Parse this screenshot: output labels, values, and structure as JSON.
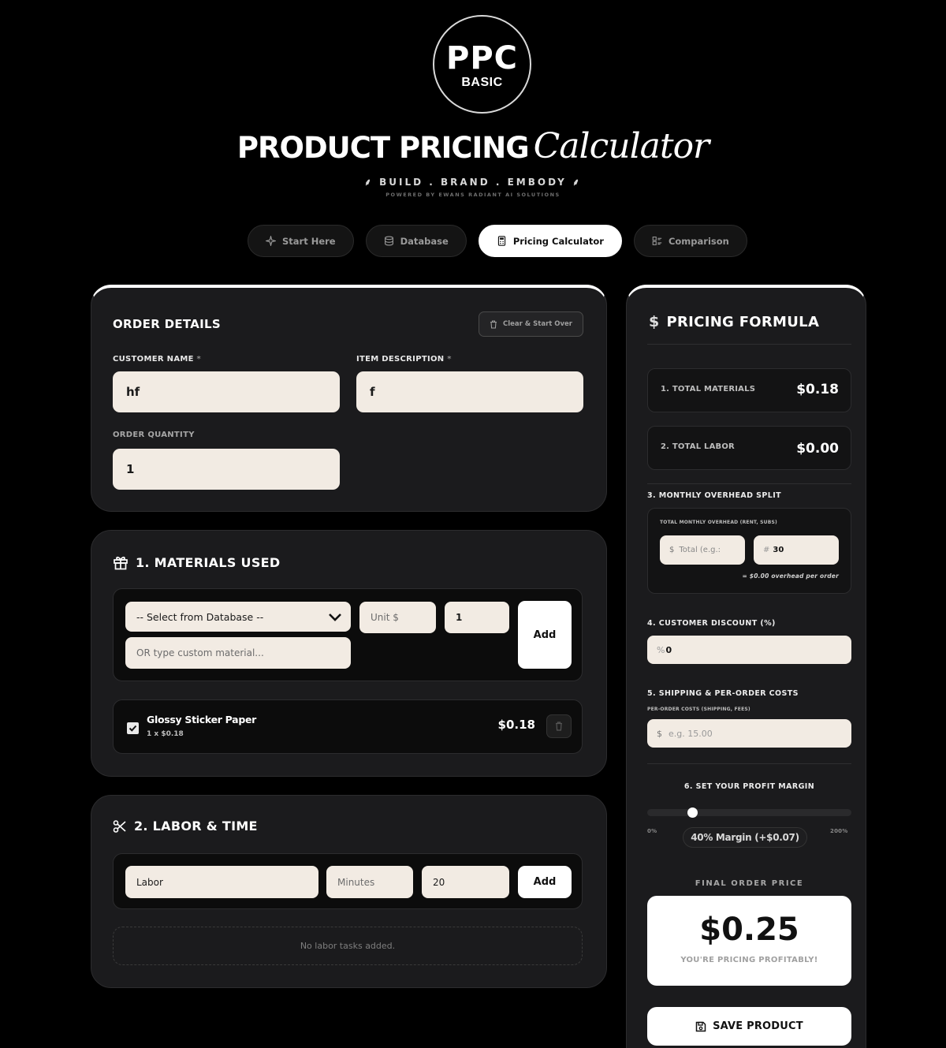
{
  "logo": {
    "main": "PPC",
    "sub": "BASIC"
  },
  "header": {
    "title_bold": "PRODUCT PRICING",
    "title_script": "Calculator",
    "tagline": "BUILD . BRAND . EMBODY",
    "powered_by": "POWERED BY EWANS RADIANT AI SOLUTIONS"
  },
  "tabs": [
    {
      "label": "Start Here",
      "icon": "sparkle-icon"
    },
    {
      "label": "Database",
      "icon": "database-icon"
    },
    {
      "label": "Pricing Calculator",
      "icon": "calculator-icon",
      "active": true
    },
    {
      "label": "Comparison",
      "icon": "comparison-icon"
    }
  ],
  "order": {
    "heading": "ORDER DETAILS",
    "clear_button": "Clear & Start Over",
    "customer_label": "CUSTOMER NAME",
    "customer_value": "hf",
    "item_label": "ITEM DESCRIPTION",
    "item_value": "f",
    "required_mark": "*",
    "quantity_label": "ORDER QUANTITY",
    "quantity_value": "1"
  },
  "materials": {
    "heading": "1. MATERIALS USED",
    "select_placeholder": "-- Select from Database --",
    "custom_placeholder": "OR type custom material...",
    "unit_placeholder": "Unit $",
    "qty_value": "1",
    "add_label": "Add",
    "items": [
      {
        "name": "Glossy Sticker Paper",
        "detail": "1 x $0.18",
        "price": "$0.18",
        "checked": true
      }
    ]
  },
  "labor": {
    "heading": "2. LABOR & TIME",
    "task_value": "Labor",
    "minutes_placeholder": "Minutes",
    "rate_value": "20",
    "add_label": "Add",
    "empty_text": "No labor tasks added."
  },
  "formula": {
    "heading": "PRICING FORMULA",
    "total_materials_label": "1. TOTAL MATERIALS",
    "total_materials_value": "$0.18",
    "total_labor_label": "2. TOTAL LABOR",
    "total_labor_value": "$0.00",
    "overhead_label": "3. MONTHLY OVERHEAD SPLIT",
    "overhead_sub": "TOTAL MONTHLY OVERHEAD (RENT, SUBS)",
    "overhead_prefix": "$",
    "overhead_placeholder": "Total (e.g.:",
    "orders_prefix": "#",
    "orders_value": "30",
    "overhead_note": "= $0.00 overhead per order",
    "discount_label": "4. CUSTOMER DISCOUNT (%)",
    "discount_prefix": "%",
    "discount_value": "0",
    "shipping_label": "5. SHIPPING & PER-ORDER COSTS",
    "shipping_sub": "PER-ORDER COSTS (SHIPPING, FEES)",
    "shipping_prefix": "$",
    "shipping_placeholder": "e.g. 15.00",
    "margin_label": "6. SET YOUR PROFIT MARGIN",
    "margin_min": "0%",
    "margin_max": "200%",
    "margin_value": 40,
    "margin_max_value": 200,
    "margin_pill": "40% Margin (+$0.07)",
    "final_label": "FINAL ORDER PRICE",
    "final_price": "$0.25",
    "final_message": "YOU'RE PRICING PROFITABLY!",
    "save_label": "SAVE PRODUCT"
  }
}
